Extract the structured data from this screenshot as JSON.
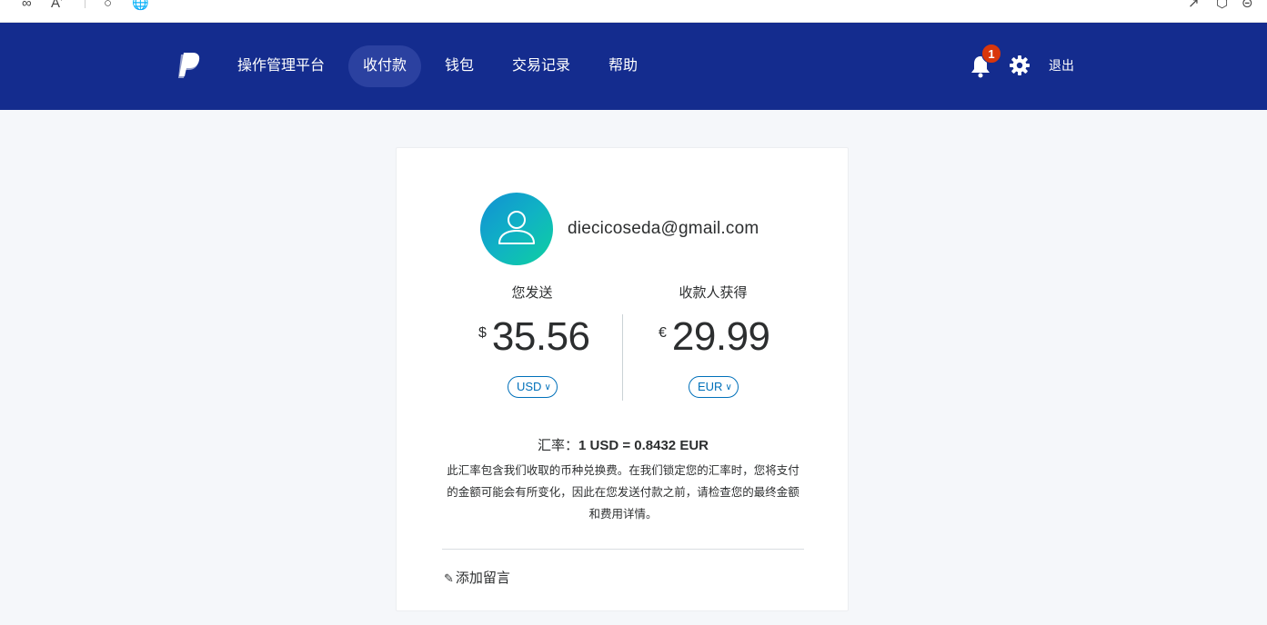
{
  "nav": {
    "items": [
      {
        "label": "操作管理平台",
        "active": false
      },
      {
        "label": "收付款",
        "active": true
      },
      {
        "label": "钱包",
        "active": false
      },
      {
        "label": "交易记录",
        "active": false
      },
      {
        "label": "帮助",
        "active": false
      }
    ],
    "notification_count": "1",
    "logout_label": "退出"
  },
  "recipient": {
    "email": "diecicoseda@gmail.com"
  },
  "send": {
    "label": "您发送",
    "symbol": "$",
    "amount": "35.56",
    "currency": "USD"
  },
  "receive": {
    "label": "收款人获得",
    "symbol": "€",
    "amount": "29.99",
    "currency": "EUR"
  },
  "exchange": {
    "prefix": "汇率：",
    "rate": "1 USD = 0.8432 EUR",
    "note": "此汇率包含我们收取的币种兑换费。在我们锁定您的汇率时，您将支付的金额可能会有所变化，因此在您发送付款之前，请检查您的最终金额和费用详情。"
  },
  "add_note_label": "添加留言",
  "colors": {
    "nav_bg": "#142c8e",
    "nav_active": "#2b41a0",
    "badge": "#d9360b",
    "link": "#0070ba",
    "page_bg": "#f5f7fa"
  },
  "icons": [
    "link-icon",
    "read-aloud-icon",
    "circle-icon",
    "globe-icon",
    "paypal-logo-icon",
    "bell-icon",
    "gear-icon",
    "user-icon",
    "chevron-down-icon",
    "pencil-icon"
  ]
}
